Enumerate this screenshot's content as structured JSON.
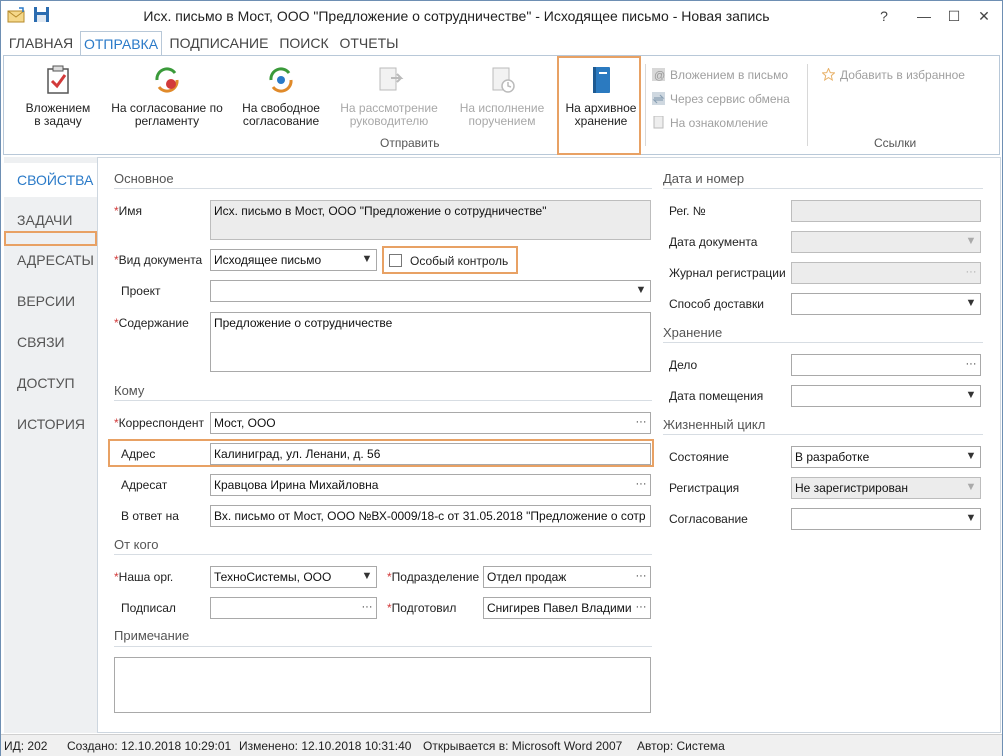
{
  "window": {
    "title": "Исх. письмо в Мост, ООО \"Предложение о сотрудничестве\" - Исходящее письмо - Новая запись",
    "help": "?",
    "minimize": "—",
    "maximize": "☐",
    "close": "✕"
  },
  "tabs": [
    "ГЛАВНАЯ",
    "ОТПРАВКА",
    "ПОДПИСАНИЕ",
    "ПОИСК",
    "ОТЧЕТЫ"
  ],
  "ribbon": {
    "btn_task": "Вложением\nв задачу",
    "btn_regulation": "На согласование по\nрегламенту",
    "btn_free": "На свободное\nсогласование",
    "btn_review": "На рассмотрение\nруководителю",
    "btn_execution": "На исполнение\nпоручением",
    "btn_archive": "На архивное\nхранение",
    "group_send": "Отправить",
    "cmd_attach_letter": "Вложением в письмо",
    "cmd_exchange": "Через сервис обмена",
    "cmd_review": "На ознакомление",
    "cmd_favorite": "Добавить в избранное",
    "group_links": "Ссылки"
  },
  "nav": [
    "СВОЙСТВА",
    "ЗАДАЧИ",
    "АДРЕСАТЫ",
    "ВЕРСИИ",
    "СВЯЗИ",
    "ДОСТУП",
    "ИСТОРИЯ"
  ],
  "main": {
    "section_main": "Основное",
    "name_label": "Имя",
    "name_value": "Исх. письмо в Мост, ООО \"Предложение о сотрудничестве\"",
    "doctype_label": "Вид документа",
    "doctype_value": "Исходящее письмо",
    "special_control": "Особый контроль",
    "project_label": "Проект",
    "project_value": "",
    "content_label": "Содержание",
    "content_value": "Предложение о сотрудничестве",
    "section_to": "Кому",
    "correspondent_label": "Корреспондент",
    "correspondent_value": "Мост, ООО",
    "address_label": "Адрес",
    "address_value": "Калиниград, ул. Ленани, д. 56",
    "addressee_label": "Адресат",
    "addressee_value": "Кравцова Ирина Михайловна",
    "reply_label": "В ответ на",
    "reply_value": "Вх. письмо от Мост, ООО №ВХ-0009/18-с от 31.05.2018 \"Предложение о сотр",
    "section_from": "От кого",
    "org_label": "Наша орг.",
    "org_value": "ТехноСистемы, ООО",
    "dept_label": "Подразделение",
    "dept_value": "Отдел продаж",
    "signed_label": "Подписал",
    "signed_value": "",
    "prepared_label": "Подготовил",
    "prepared_value": "Снигирев Павел Владимир",
    "section_note": "Примечание",
    "note_value": ""
  },
  "right": {
    "section_datenum": "Дата и номер",
    "regno_label": "Рег. №",
    "docdate_label": "Дата документа",
    "journal_label": "Журнал регистрации",
    "delivery_label": "Способ доставки",
    "section_storage": "Хранение",
    "case_label": "Дело",
    "placement_label": "Дата помещения",
    "section_lifecycle": "Жизненный цикл",
    "state_label": "Состояние",
    "state_value": "В разработке",
    "registration_label": "Регистрация",
    "registration_value": "Не зарегистрирован",
    "approval_label": "Согласование",
    "approval_value": ""
  },
  "status": {
    "id": "ИД: 202",
    "created": "Создано: 12.10.2018 10:29:01",
    "modified": "Изменено: 12.10.2018 10:31:40",
    "opens_in": "Открывается в: Microsoft Word 2007",
    "author": "Автор: Система"
  },
  "colors": {
    "accent": "#2a7ac8",
    "highlight": "#e8a164",
    "required": "#d23a3a"
  }
}
